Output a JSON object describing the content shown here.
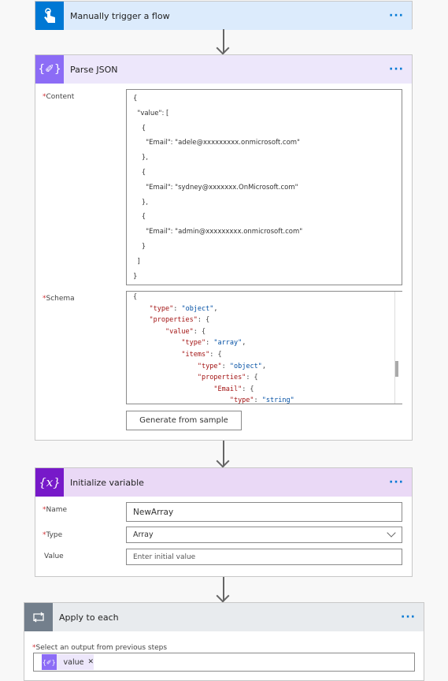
{
  "trigger": {
    "title": "Manually trigger a flow",
    "icon": "touch-icon",
    "color": "#0078d4"
  },
  "parse_json": {
    "title": "Parse JSON",
    "icon": "braces-icon",
    "color": "#8c6cf6",
    "content_label": "Content",
    "content_lines": [
      "{",
      "  \"value\": [",
      "    {",
      "      \"Email\": \"adele@xxxxxxxxx.onmicrosoft.com\"",
      "    },",
      "    {",
      "      \"Email\": \"sydney@xxxxxxx.OnMicrosoft.com\"",
      "    },",
      "    {",
      "      \"Email\": \"admin@xxxxxxxxx.onmicrosoft.com\"",
      "    }",
      "  ]",
      "}"
    ],
    "schema_label": "Schema",
    "generate_button": "Generate from sample"
  },
  "init_variable": {
    "title": "Initialize variable",
    "icon": "variable-icon",
    "color": "#7719c9",
    "name_label": "Name",
    "name_value": "NewArray",
    "type_label": "Type",
    "type_value": "Array",
    "value_label": "Value",
    "value_placeholder": "Enter initial value"
  },
  "apply_each": {
    "title": "Apply to each",
    "icon": "loop-icon",
    "color": "#737f8c",
    "select_label": "Select an output from previous steps",
    "token": "value"
  },
  "more": "···"
}
